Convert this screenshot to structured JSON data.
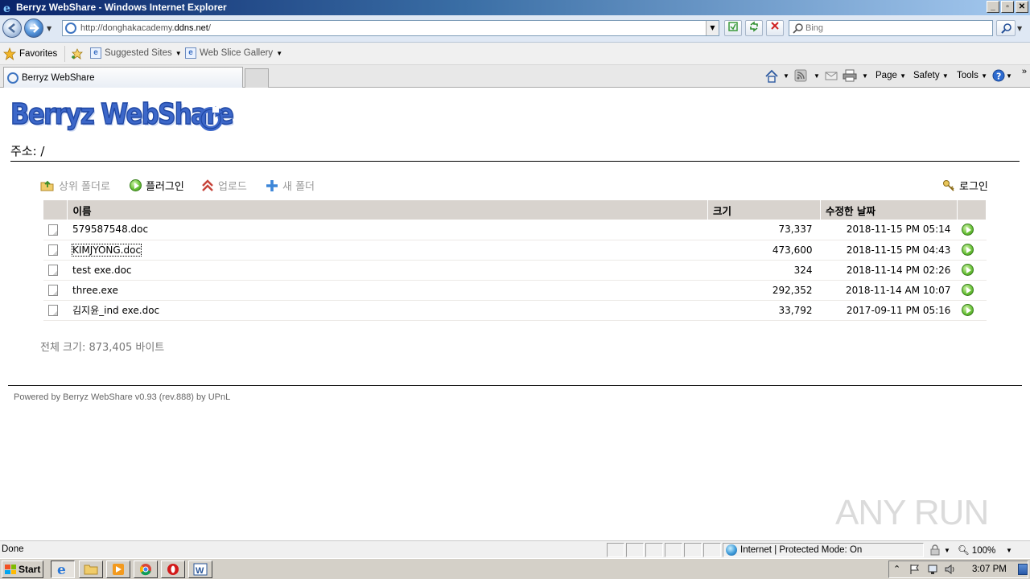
{
  "window": {
    "title": "Berryz WebShare - Windows Internet Explorer"
  },
  "navbar": {
    "url_prefix": "http://donghakacademy.",
    "url_domain": "ddns.net",
    "url_suffix": "/",
    "search_placeholder": "Bing"
  },
  "favbar": {
    "favorites": "Favorites",
    "suggested": "Suggested Sites",
    "gallery": "Web Slice Gallery"
  },
  "tabs": [
    {
      "label": "Berryz WebShare"
    }
  ],
  "commandbar": {
    "page": "Page",
    "safety": "Safety",
    "tools": "Tools"
  },
  "page": {
    "logo": "Berryz WebShare",
    "address_label": "주소: /",
    "toolbar": {
      "up_folder": "상위 폴더로",
      "plugin": "플러그인",
      "upload": "업로드",
      "new_folder": "새 폴더",
      "login": "로그인"
    },
    "columns": {
      "name": "이름",
      "size": "크기",
      "modified": "수정한 날짜"
    },
    "files": [
      {
        "name": "579587548.doc",
        "size": "73,337",
        "date": "2018-11-15 PM 05:14"
      },
      {
        "name": "KIMJYONG.doc",
        "size": "473,600",
        "date": "2018-11-15 PM 04:43"
      },
      {
        "name": "test exe.doc",
        "size": "324",
        "date": "2018-11-14 PM 02:26"
      },
      {
        "name": "three.exe",
        "size": "292,352",
        "date": "2018-11-14 AM 10:07"
      },
      {
        "name": "김지윤_ind exe.doc",
        "size": "33,792",
        "date": "2017-09-11 PM 05:16"
      }
    ],
    "total": "전체 크기: 873,405 바이트",
    "footer": "Powered by Berryz WebShare v0.93 (rev.888) by UPnL",
    "watermark": "ANY RUN"
  },
  "statusbar": {
    "status": "Done",
    "zone": "Internet | Protected Mode: On",
    "zoom": "100%"
  },
  "taskbar": {
    "start": "Start",
    "clock": "3:07 PM"
  },
  "colors": {
    "titlebar": "#0a246a",
    "logo_blue": "#3c67c9",
    "header_bg": "#d8d3ce",
    "play_green": "#6cc43a"
  }
}
